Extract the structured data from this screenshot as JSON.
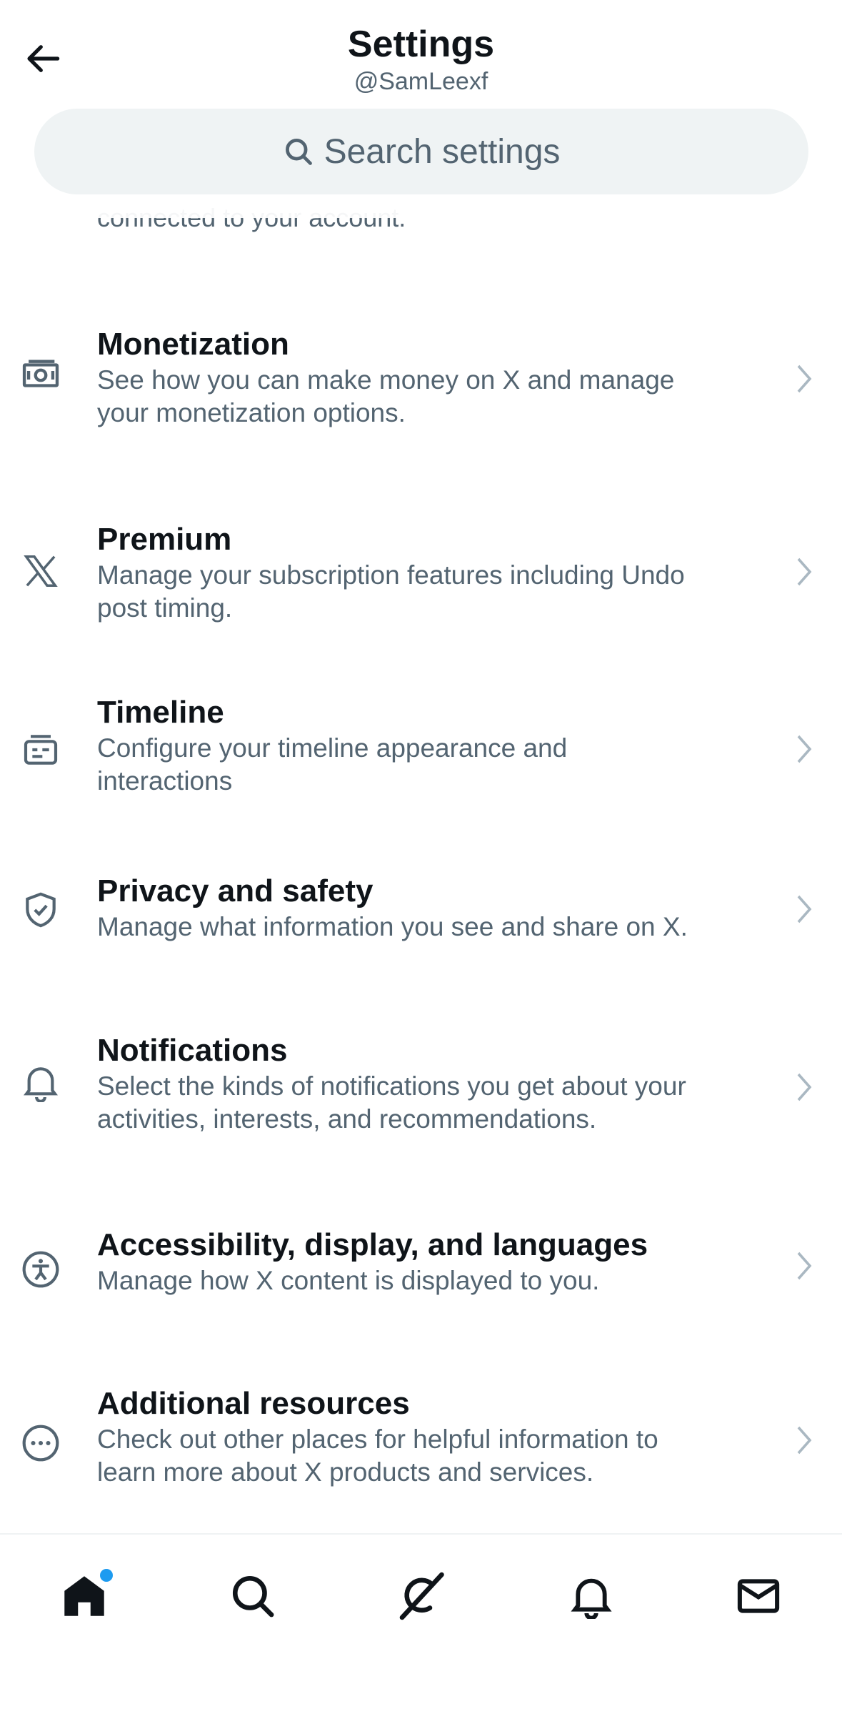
{
  "header": {
    "title": "Settings",
    "handle": "@SamLeexf"
  },
  "search": {
    "placeholder": "Search settings"
  },
  "clipped_description": "connected to your account.",
  "items": [
    {
      "title": "Monetization",
      "desc_lines": [
        "See how you can make money on X and manage",
        "your monetization options."
      ],
      "icon": "money-icon"
    },
    {
      "title": "Premium",
      "desc_lines": [
        "Manage your subscription features including Undo",
        "post timing."
      ],
      "icon": "x-logo-icon"
    },
    {
      "title": "Timeline",
      "desc_lines": [
        "Configure your timeline appearance and",
        "interactions"
      ],
      "icon": "timeline-icon"
    },
    {
      "title": "Privacy and safety",
      "desc_lines": [
        "Manage what information you see and share on X."
      ],
      "icon": "shield-check-icon"
    },
    {
      "title": "Notifications",
      "desc_lines": [
        "Select the kinds of notifications you get about your",
        "activities, interests, and recommendations."
      ],
      "icon": "bell-icon"
    },
    {
      "title": "Accessibility, display, and languages",
      "desc_lines": [
        "Manage how X content is displayed to you."
      ],
      "icon": "accessibility-icon"
    },
    {
      "title": "Additional resources",
      "desc_lines": [
        "Check out other places for helpful information to",
        "learn more about X products and services."
      ],
      "icon": "more-circle-icon"
    }
  ],
  "nav": {
    "items": [
      "home-icon",
      "search-icon",
      "grok-icon",
      "bell-icon",
      "mail-icon"
    ]
  },
  "colors": {
    "primary_text": "#0f1419",
    "secondary_text": "#536471",
    "search_bg": "#eff3f4",
    "accent": "#1d9bf0",
    "chevron": "#aab8c2"
  }
}
